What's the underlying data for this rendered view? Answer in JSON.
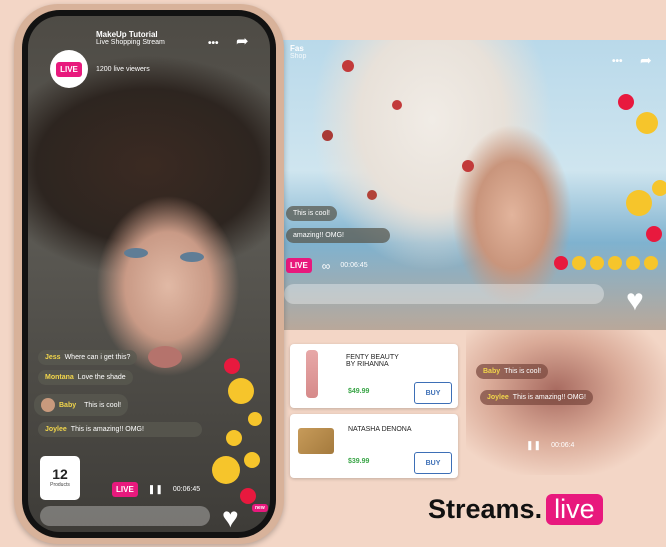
{
  "phone": {
    "title": "MakeUp Tutorial",
    "subtitle": "Live Shopping Stream",
    "viewers": "1200 live viewers",
    "live_badge": "LIVE",
    "more_label": "•••",
    "share_label": "➦",
    "comments": [
      {
        "user": "Jess",
        "text": "Where can i get this?"
      },
      {
        "user": "Montana",
        "text": "Love the shade"
      },
      {
        "user": "Baby",
        "text": "This is cool!"
      },
      {
        "user": "Joylee",
        "text": "This is amazing!! OMG!"
      }
    ],
    "product_count": "12",
    "product_label": "Products",
    "player": {
      "live": "LIVE",
      "pause": "❚❚",
      "time": "00:06:45"
    },
    "new_badge": "new"
  },
  "stream": {
    "partial_title": "Fas",
    "partial_subtitle": "Shop",
    "more_label": "•••",
    "comments": [
      {
        "user": "",
        "text": "This is cool!"
      },
      {
        "user": "",
        "text": "amazing!! OMG!"
      }
    ],
    "player": {
      "live": "LIVE",
      "time": "00:06:45"
    },
    "products": [
      {
        "name_line1": "FENTY BEAUTY",
        "name_line2": "BY RIHANNA",
        "price": "$49.99",
        "button": "BUY"
      },
      {
        "name_line1": "NATASHA DENONA",
        "name_line2": "",
        "price": "$39.99",
        "button": "BUY"
      }
    ],
    "faded_comments": [
      {
        "user": "Baby",
        "text": "This is cool!"
      },
      {
        "user": "Joylee",
        "text": "This is amazing!! OMG!"
      }
    ],
    "faded_time": "00:06:4"
  },
  "logo": {
    "main": "Streams.",
    "highlight": "live"
  },
  "colors": {
    "accent": "#e8197d",
    "buy": "#3d6fb6",
    "price": "#3aa547",
    "bg": "#f3d6c6"
  }
}
